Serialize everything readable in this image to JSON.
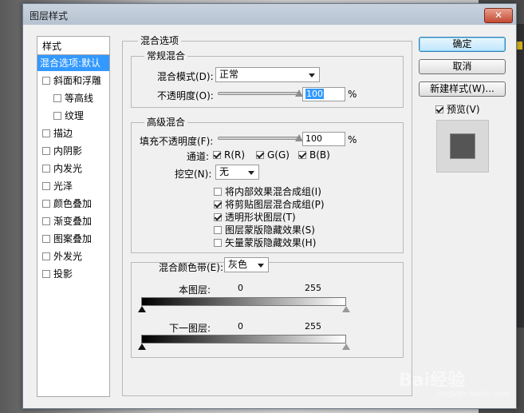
{
  "dialog": {
    "title": "图层样式",
    "close": "✕"
  },
  "styles": {
    "header": "样式",
    "items": [
      {
        "label": "混合选项:默认",
        "checkbox": false,
        "selected": true,
        "indent": false
      },
      {
        "label": "斜面和浮雕",
        "checkbox": true,
        "checked": false,
        "indent": false
      },
      {
        "label": "等高线",
        "checkbox": true,
        "checked": false,
        "indent": true
      },
      {
        "label": "纹理",
        "checkbox": true,
        "checked": false,
        "indent": true
      },
      {
        "label": "描边",
        "checkbox": true,
        "checked": false,
        "indent": false
      },
      {
        "label": "内阴影",
        "checkbox": true,
        "checked": false,
        "indent": false
      },
      {
        "label": "内发光",
        "checkbox": true,
        "checked": false,
        "indent": false
      },
      {
        "label": "光泽",
        "checkbox": true,
        "checked": false,
        "indent": false
      },
      {
        "label": "颜色叠加",
        "checkbox": true,
        "checked": false,
        "indent": false
      },
      {
        "label": "渐变叠加",
        "checkbox": true,
        "checked": false,
        "indent": false
      },
      {
        "label": "图案叠加",
        "checkbox": true,
        "checked": false,
        "indent": false
      },
      {
        "label": "外发光",
        "checkbox": true,
        "checked": false,
        "indent": false
      },
      {
        "label": "投影",
        "checkbox": true,
        "checked": false,
        "indent": false
      }
    ]
  },
  "blending": {
    "section_title": "混合选项",
    "general": {
      "title": "常规混合",
      "blend_mode_label": "混合模式(D):",
      "blend_mode_value": "正常",
      "opacity_label": "不透明度(O):",
      "opacity_value": "100",
      "opacity_unit": "%",
      "opacity_level": 1.0
    },
    "advanced": {
      "title": "高级混合",
      "fill_opacity_label": "填充不透明度(F):",
      "fill_opacity_value": "100",
      "fill_opacity_unit": "%",
      "fill_opacity_level": 1.0,
      "channels_label": "通道:",
      "channel_r": "R(R)",
      "channel_g": "G(G)",
      "channel_b": "B(B)",
      "knockout_label": "挖空(N):",
      "knockout_value": "无",
      "options": [
        {
          "label": "将内部效果混合成组(I)",
          "checked": false
        },
        {
          "label": "将剪贴图层混合成组(P)",
          "checked": true
        },
        {
          "label": "透明形状图层(T)",
          "checked": true
        },
        {
          "label": "图层蒙版隐藏效果(S)",
          "checked": false
        },
        {
          "label": "矢量蒙版隐藏效果(H)",
          "checked": false
        }
      ]
    },
    "blend_if": {
      "label": "混合颜色带(E):",
      "value": "灰色",
      "this_layer_label": "本图层:",
      "this_layer_min": "0",
      "this_layer_max": "255",
      "underlying_label": "下一图层:",
      "underlying_min": "0",
      "underlying_max": "255"
    }
  },
  "buttons": {
    "ok": "确定",
    "cancel": "取消",
    "new_style": "新建样式(W)...",
    "preview_label": "预览(V)"
  },
  "watermark": {
    "brand": "Bai经验",
    "url": "jingyan.baidu.com"
  }
}
